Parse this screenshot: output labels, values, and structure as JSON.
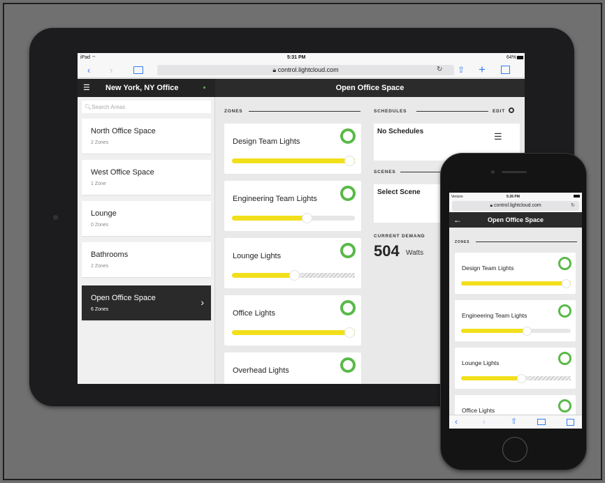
{
  "ipad": {
    "status": {
      "device": "iPad",
      "time": "5:31 PM",
      "battery": "64%"
    },
    "browser": {
      "url": "control.lightcloud.com",
      "back_icon": "chevron-left",
      "forward_icon": "chevron-right",
      "bookmarks_icon": "book",
      "reload_icon": "reload",
      "share_icon": "share",
      "new_tab_icon": "plus",
      "tabs_icon": "tabs"
    },
    "sidebar": {
      "location": "New York, NY Office",
      "search_placeholder": "Search Areas",
      "areas": [
        {
          "name": "North Office Space",
          "zones": "2 Zones"
        },
        {
          "name": "West Office Space",
          "zones": "1 Zone"
        },
        {
          "name": "Lounge",
          "zones": "0 Zones"
        },
        {
          "name": "Bathrooms",
          "zones": "2 Zones"
        },
        {
          "name": "Open Office Space",
          "zones": "6 Zones",
          "active": true
        }
      ]
    },
    "main": {
      "title": "Open Office Space",
      "zones_label": "ZONES",
      "zones": [
        {
          "name": "Design Team Lights",
          "level": 1.0,
          "unreachable": false
        },
        {
          "name": "Engineering Team Lights",
          "level": 0.6,
          "unreachable": false
        },
        {
          "name": "Lounge Lights",
          "level": 0.5,
          "unreachable": true
        },
        {
          "name": "Office Lights",
          "level": 1.0,
          "unreachable": false
        },
        {
          "name": "Overhead Lights",
          "level": 1.0,
          "unreachable": false
        }
      ],
      "schedules_label": "SCHEDULES",
      "edit_label": "EDIT",
      "schedules_text": "No Schedules",
      "scenes_label": "SCENES",
      "scenes_text": "Select Scene",
      "demand_label": "CURRENT DEMAND",
      "demand_value": "504",
      "demand_unit": "Watts"
    }
  },
  "iphone": {
    "status": {
      "carrier": "Verizon",
      "time": "5:26 PM"
    },
    "url": "control.lightcloud.com",
    "title": "Open Office Space",
    "zones_label": "ZONES",
    "zones": [
      {
        "name": "Design Team Lights",
        "level": 1.0,
        "unreachable": false
      },
      {
        "name": "Engineering Team Lights",
        "level": 0.6,
        "unreachable": false
      },
      {
        "name": "Lounge Lights",
        "level": 0.55,
        "unreachable": true
      },
      {
        "name": "Office Lights",
        "level": 1.0,
        "unreachable": false
      }
    ]
  },
  "colors": {
    "accent_yellow": "#f2df1b",
    "ring_green": "#59b948",
    "header_dark": "#2b2b2b",
    "link_blue": "#2f7cf6"
  }
}
